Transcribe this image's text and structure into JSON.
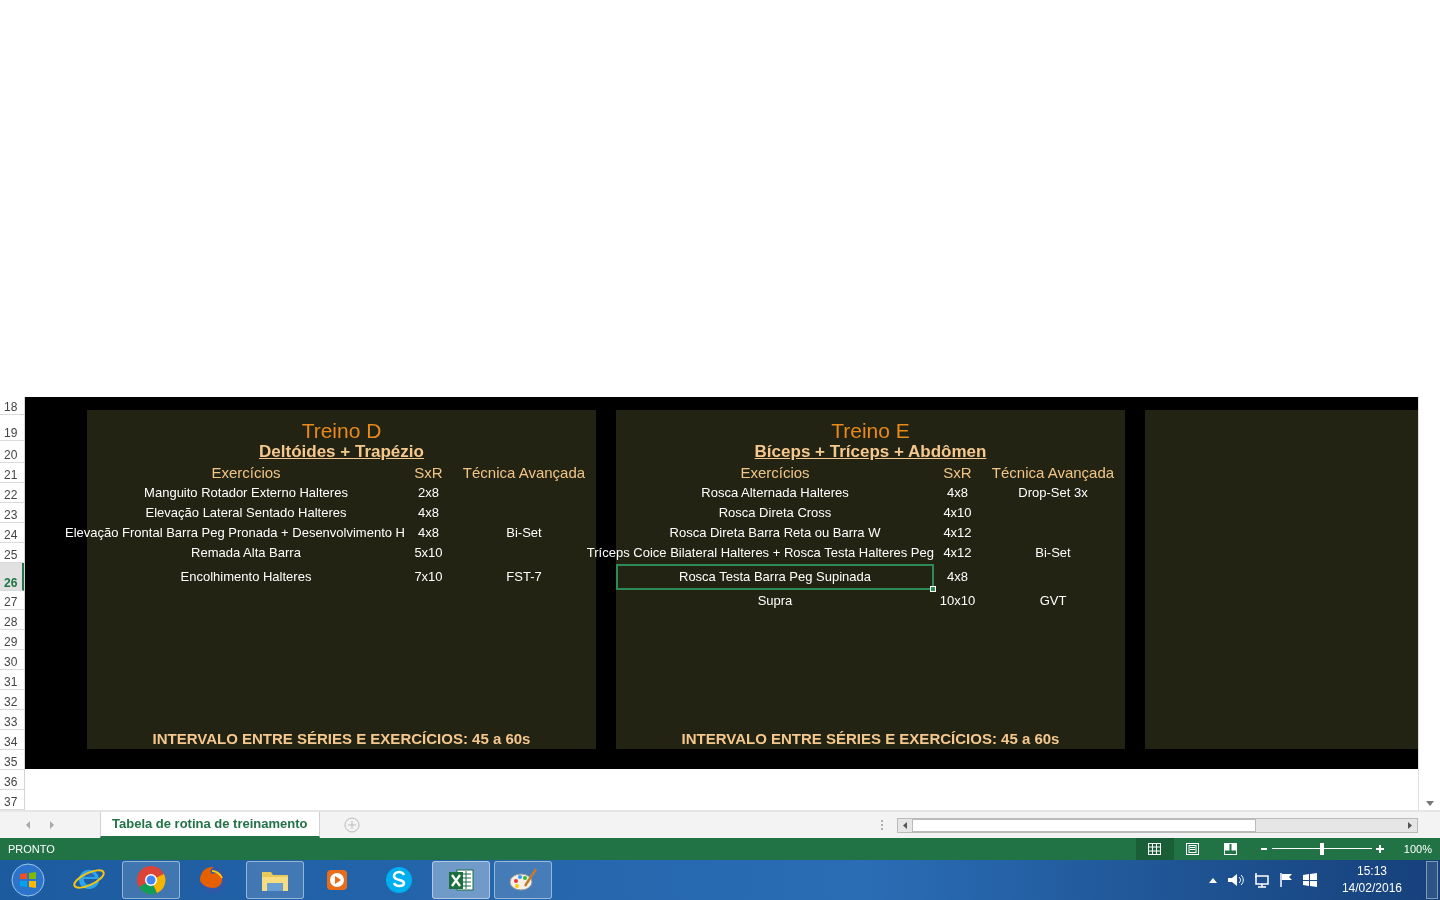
{
  "row_headers": [
    {
      "label": "18",
      "selected": false
    },
    {
      "label": "19",
      "selected": false
    },
    {
      "label": "20",
      "selected": false
    },
    {
      "label": "21",
      "selected": false
    },
    {
      "label": "22",
      "selected": false
    },
    {
      "label": "23",
      "selected": false
    },
    {
      "label": "24",
      "selected": false
    },
    {
      "label": "25",
      "selected": false
    },
    {
      "label": "26",
      "selected": true
    },
    {
      "label": "27",
      "selected": false
    },
    {
      "label": "28",
      "selected": false
    },
    {
      "label": "29",
      "selected": false
    },
    {
      "label": "30",
      "selected": false
    },
    {
      "label": "31",
      "selected": false
    },
    {
      "label": "32",
      "selected": false
    },
    {
      "label": "33",
      "selected": false
    },
    {
      "label": "34",
      "selected": false
    },
    {
      "label": "35",
      "selected": false
    },
    {
      "label": "36",
      "selected": false
    },
    {
      "label": "37",
      "selected": false
    }
  ],
  "panels": [
    {
      "kind": "workout",
      "title": "Treino D",
      "subtitle": "Deltóides + Trapézio",
      "columns": [
        "Exercícios",
        "SxR",
        "Técnica Avançada"
      ],
      "rows": [
        {
          "exercise": "Manguito Rotador Externo Halteres",
          "sets": "2x8",
          "selected": false
        },
        {
          "exercise": "Elevação Lateral Sentado Halteres",
          "sets": "4x8",
          "selected": false
        },
        {
          "exercise": "Elevação Frontal Barra Peg Pronada + Desenvolvimento H",
          "sets": "4x8",
          "technique": "Bi-Set",
          "selected": false
        },
        {
          "exercise": "Remada Alta Barra",
          "sets": "5x10",
          "selected": false
        },
        {
          "exercise": "Encolhimento Halteres",
          "sets": "7x10",
          "technique": "FST-7",
          "selected": false
        }
      ],
      "footer": "INTERVALO ENTRE SÉRIES E EXERCÍCIOS: 45 a 60s"
    },
    {
      "kind": "workout",
      "title": "Treino E",
      "subtitle": "Bíceps + Tríceps + Abdômen",
      "columns": [
        "Exercícios",
        "SxR",
        "Técnica Avançada"
      ],
      "rows": [
        {
          "exercise": "Rosca Alternada Halteres",
          "sets": "4x8",
          "technique": "Drop-Set 3x",
          "selected": false
        },
        {
          "exercise": "Rosca Direta Cross",
          "sets": "4x10",
          "selected": false
        },
        {
          "exercise": "Rosca Direta Barra Reta ou Barra W",
          "sets": "4x12",
          "selected": false
        },
        {
          "exercise": "Tríceps Coice Bilateral Halteres + Rosca Testa Halteres Peg",
          "sets": "4x12",
          "technique": "Bi-Set",
          "selected": false
        },
        {
          "exercise": "Rosca Testa Barra Peg Supinada",
          "sets": "4x8",
          "selected": true
        },
        {
          "exercise": "Supra",
          "sets": "10x10",
          "technique": "GVT",
          "selected": false
        }
      ],
      "footer": "INTERVALO ENTRE SÉRIES E EXERCÍCIOS: 45 a 60s"
    },
    {
      "kind": "blank"
    }
  ],
  "sheet_tabs": [
    {
      "label": "Tabela de rotina de treinamento",
      "selected": true
    }
  ],
  "status_bar": {
    "text": "PRONTO",
    "views": [
      {
        "kind": "normal",
        "selected": true
      },
      {
        "kind": "page_layout",
        "selected": false
      },
      {
        "kind": "page_break",
        "selected": false
      }
    ],
    "zoom_slider": {
      "level": 0.5
    },
    "zoom": "100%"
  },
  "taskbar": {
    "apps": [
      {
        "kind": "ie",
        "running": false,
        "selected": false
      },
      {
        "kind": "chrome",
        "running": true,
        "selected": false
      },
      {
        "kind": "firefox",
        "running": false,
        "selected": false
      },
      {
        "kind": "folder",
        "running": true,
        "selected": false
      },
      {
        "kind": "player",
        "running": false,
        "selected": false
      },
      {
        "kind": "skype",
        "running": false,
        "selected": false
      },
      {
        "kind": "excel",
        "running": true,
        "selected": true
      },
      {
        "kind": "paint",
        "running": true,
        "selected": false
      }
    ],
    "time": "15:13",
    "date": "14/02/2016"
  }
}
